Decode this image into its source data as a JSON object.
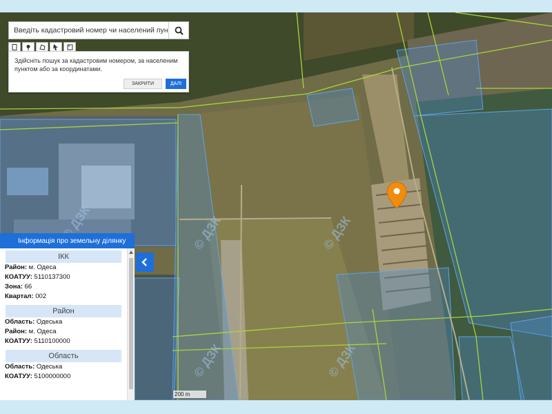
{
  "search": {
    "placeholder": "Введіть кадастровий номер чи населений пункт"
  },
  "tooltip": {
    "text": "Здійсніть пошук за кадастровим номером, за населеним пунктом або за координатами.",
    "close_label": "ЗАКРИТИ",
    "next_label": "ДАЛІ"
  },
  "toolbar": {
    "icons": [
      "document-icon",
      "pin-icon",
      "polygon-icon",
      "pointer-icon",
      "ruler-icon"
    ]
  },
  "map": {
    "watermark": "© ДЗК",
    "scale_label": "200 m",
    "marker_color": "#f28c0f"
  },
  "panel": {
    "title": "Інформація про земельну ділянку",
    "sections": [
      {
        "heading": "ІКК",
        "rows": [
          {
            "key": "Район:",
            "value": " м. Одеса"
          },
          {
            "key": "КОАТУУ:",
            "value": " 5110137300"
          },
          {
            "key": "Зона:",
            "value": " 66"
          },
          {
            "key": "Квартал:",
            "value": " 002"
          }
        ]
      },
      {
        "heading": "Район",
        "rows": [
          {
            "key": "Область:",
            "value": " Одеська"
          },
          {
            "key": "Район:",
            "value": " м. Одеса"
          },
          {
            "key": "КОАТУУ:",
            "value": " 5110100000"
          }
        ]
      },
      {
        "heading": "Область",
        "rows": [
          {
            "key": "Область:",
            "value": " Одеська"
          },
          {
            "key": "КОАТУУ:",
            "value": " 5100000000"
          }
        ]
      }
    ]
  },
  "colors": {
    "accent": "#1e6fd9",
    "section_bg": "#d6e6f7",
    "parcel_line": "#a8d63a",
    "parcel_fill": "#4d88c9"
  }
}
